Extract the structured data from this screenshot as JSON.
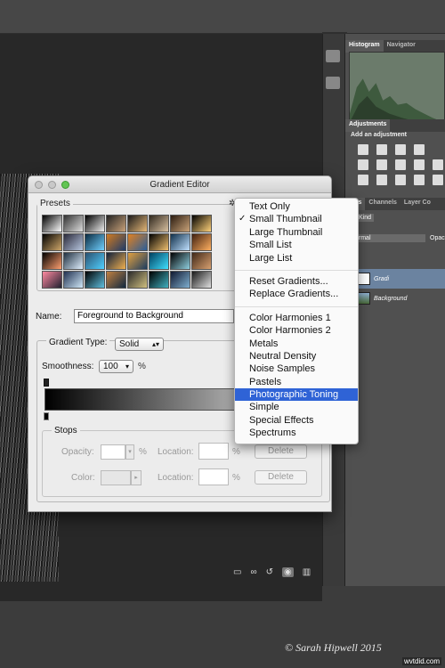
{
  "panels": {
    "tabs_top": [
      "Histogram",
      "Navigator"
    ],
    "adjustments_tab": "Adjustments",
    "add_adjustment": "Add an adjustment",
    "layer_tabs": [
      "yers",
      "Channels",
      "Layer Co"
    ],
    "kind_filter": "Kind",
    "blend_mode": "ormal",
    "opacity_label": "Opaci",
    "layers": [
      {
        "name": "Gradi",
        "selected": true
      },
      {
        "name": "Background",
        "selected": false
      }
    ]
  },
  "dialog": {
    "title": "Gradient Editor",
    "presets_label": "Presets",
    "name_label": "Name:",
    "name_value": "Foreground to Background",
    "gradient_type_label": "Gradient Type:",
    "gradient_type_value": "Solid",
    "smoothness_label": "Smoothness:",
    "smoothness_value": "100",
    "smoothness_unit": "%",
    "stops_label": "Stops",
    "opacity_label": "Opacity:",
    "color_label": "Color:",
    "location_label": "Location:",
    "percent": "%",
    "delete_label": "Delete"
  },
  "menu": {
    "groups": [
      [
        {
          "label": "Text Only",
          "checked": false
        },
        {
          "label": "Small Thumbnail",
          "checked": true
        },
        {
          "label": "Large Thumbnail",
          "checked": false
        },
        {
          "label": "Small List",
          "checked": false
        },
        {
          "label": "Large List",
          "checked": false
        }
      ],
      [
        {
          "label": "Reset Gradients...",
          "checked": false
        },
        {
          "label": "Replace Gradients...",
          "checked": false
        }
      ],
      [
        {
          "label": "Color Harmonies 1"
        },
        {
          "label": "Color Harmonies 2"
        },
        {
          "label": "Metals"
        },
        {
          "label": "Neutral Density"
        },
        {
          "label": "Noise Samples"
        },
        {
          "label": "Pastels"
        },
        {
          "label": "Photographic Toning",
          "highlighted": true
        },
        {
          "label": "Simple"
        },
        {
          "label": "Special Effects"
        },
        {
          "label": "Spectrums"
        }
      ]
    ]
  },
  "watermark": "© Sarah Hipwell 2015",
  "watermark_logo": "wvtdid.com",
  "colors": {
    "highlight": "#2f63d6",
    "selected_layer": "#6b83a0"
  }
}
